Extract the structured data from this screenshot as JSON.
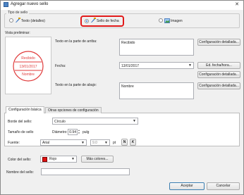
{
  "window": {
    "title": "Agregar nuevo sello",
    "close_glyph": "✕"
  },
  "stamp_type": {
    "group_label": "Tipo de sello",
    "options": [
      {
        "label": "Texto (detalles)",
        "selected": false,
        "icon": "text-stamp-icon"
      },
      {
        "label": "Sello de fecha",
        "selected": true,
        "icon": "date-stamp-icon"
      },
      {
        "label": "Imagen",
        "selected": false,
        "icon": "image-stamp-icon"
      }
    ],
    "highlight_color": "#e11a1a"
  },
  "preview": {
    "label": "Vista preliminar:",
    "stamp_top": "Recibido",
    "stamp_date": "13/01/2017",
    "stamp_bottom": "Nombre",
    "stamp_color": "#e03a3a"
  },
  "fields": {
    "top_text_label": "Texto en la parte de arriba:",
    "top_text_value": "Recibido",
    "top_detail_button": "Configuración detallada...",
    "date_label": "Fecha:",
    "date_value": "13/01/2017",
    "date_format_button": "Ed. fecha/hora...",
    "date_detail_button": "Configuración detallada...",
    "bottom_text_label": "Texto en la parte de abajo:",
    "bottom_text_value": "Nombre",
    "bottom_detail_button": "Configuración detallada..."
  },
  "tabs": [
    {
      "label": "Configuración básica",
      "active": true
    },
    {
      "label": "Otras opciones de configuración",
      "active": false
    }
  ],
  "basic": {
    "border_label": "Borde del sello:",
    "border_value": "Círculo",
    "size_label": "Tamaño de sello",
    "diameter_label": "Diámetro:",
    "diameter_value": "0.94",
    "diameter_unit": "pulg",
    "font_label": "Fuente:",
    "font_value": "Arial",
    "font_size_value": "9.0",
    "font_size_unit": "pt",
    "bold_label": "N",
    "italic_label": "K",
    "color_label": "Color del sello:",
    "color_value": "Rojo",
    "color_swatch": "#e01010",
    "more_colors_button": "Más colores..."
  },
  "name": {
    "label": "Nombre del sello:",
    "value": ""
  },
  "footer": {
    "accept": "Aceptar",
    "cancel": "Cancelar"
  }
}
